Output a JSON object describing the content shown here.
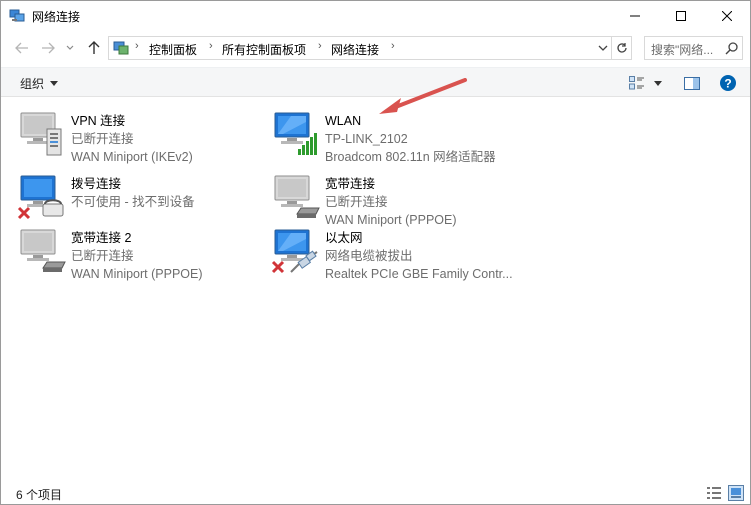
{
  "window": {
    "title": "网络连接"
  },
  "address": {
    "crumbs": [
      "控制面板",
      "所有控制面板项",
      "网络连接"
    ],
    "search_placeholder": "搜索\"网络..."
  },
  "toolbar": {
    "organize_label": "组织"
  },
  "connections": [
    {
      "name": "VPN 连接",
      "status": "已断开连接",
      "device": "WAN Miniport (IKEv2)",
      "icon": "vpn-connection-icon"
    },
    {
      "name": "WLAN",
      "status": "TP-LINK_2102",
      "device": "Broadcom 802.11n 网络适配器",
      "icon": "wifi-signal-icon"
    },
    {
      "name": "拨号连接",
      "status": "不可使用 - 找不到设备",
      "device": "",
      "icon": "dialup-modem-icon"
    },
    {
      "name": "宽带连接",
      "status": "已断开连接",
      "device": "WAN Miniport (PPPOE)",
      "icon": "broadband-icon"
    },
    {
      "name": "宽带连接 2",
      "status": "已断开连接",
      "device": "WAN Miniport (PPPOE)",
      "icon": "broadband-icon"
    },
    {
      "name": "以太网",
      "status": "网络电缆被拔出",
      "device": "Realtek PCIe GBE Family Contr...",
      "icon": "ethernet-icon"
    }
  ],
  "status_bar": {
    "item_count": "6 个项目"
  },
  "colors": {
    "accent": "#0078d7",
    "error_red": "#d13438",
    "signal_green": "#2e9b2e",
    "arrow_red": "#d9534f"
  }
}
